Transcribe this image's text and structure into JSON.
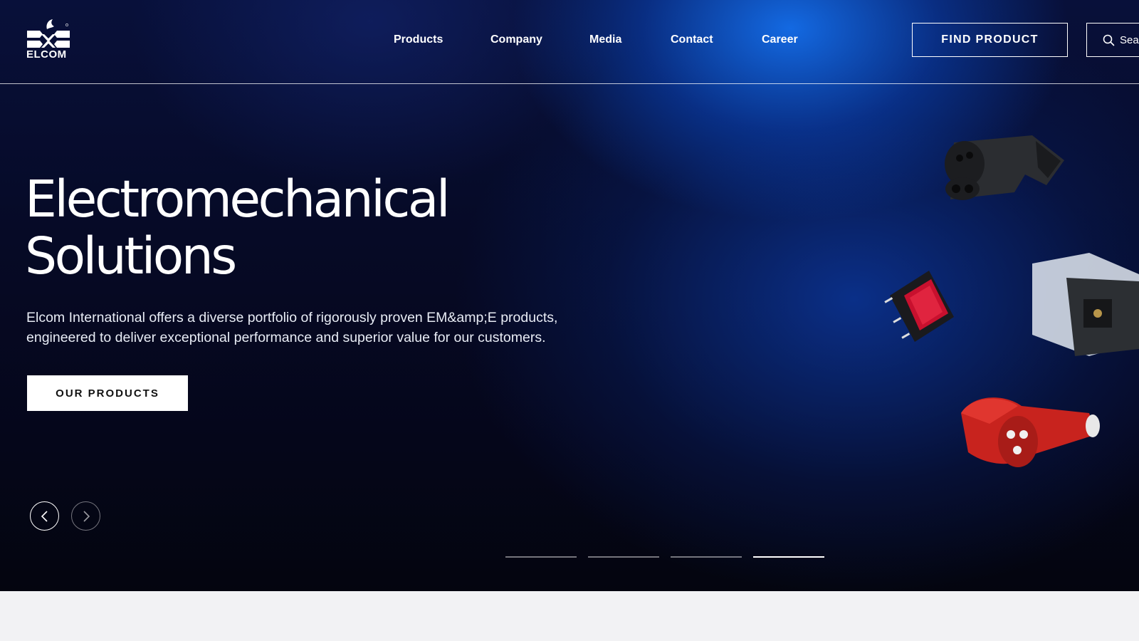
{
  "brand": {
    "name": "ELCOM"
  },
  "nav": {
    "items": [
      {
        "label": "Products"
      },
      {
        "label": "Company"
      },
      {
        "label": "Media"
      },
      {
        "label": "Contact"
      },
      {
        "label": "Career"
      }
    ]
  },
  "header": {
    "find_product_label": "FIND PRODUCT",
    "search_label": "Search"
  },
  "hero": {
    "headline_line1": "Electromechanical",
    "headline_line2": "Solutions",
    "subtitle_line1": "Elcom International offers a diverse portfolio of rigorously proven EM&amp;E products,",
    "subtitle_line2": "engineered to deliver exceptional performance and superior value for our customers.",
    "cta_label": "OUR PRODUCTS",
    "slides_total": 4,
    "active_slide": 4
  },
  "icons": {
    "prev": "chevron-left-icon",
    "next": "chevron-right-icon",
    "search": "search-icon"
  },
  "colors": {
    "hero_bg": "#05061a",
    "hero_glow": "#146eeb",
    "cta_bg": "#ffffff",
    "page_bg": "#f2f2f4"
  }
}
